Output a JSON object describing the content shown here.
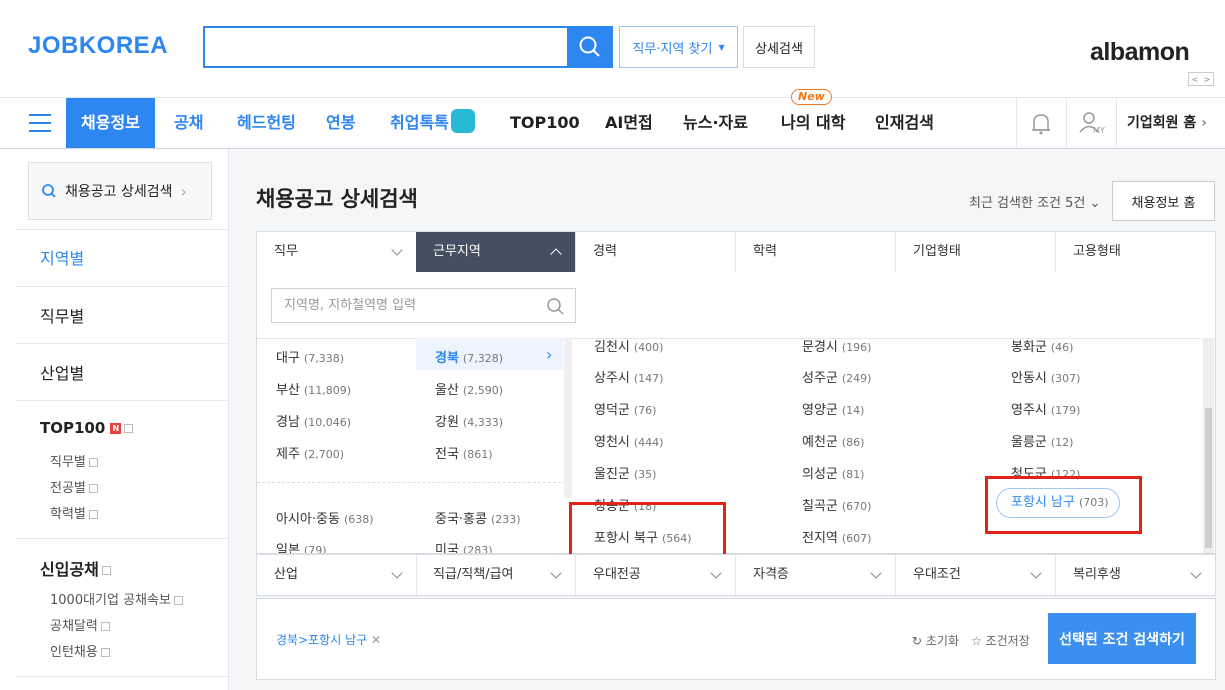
{
  "header": {
    "logo": "JOBKOREA",
    "search_value": "",
    "find_label": "직무·지역 찾기",
    "detail_label": "상세검색",
    "albamon": "albamon"
  },
  "gnb": {
    "items": [
      "채용정보",
      "공채",
      "헤드헌팅",
      "연봉",
      "취업톡톡",
      "TOP100",
      "AI면접",
      "뉴스·자료",
      "나의 대학",
      "인재검색"
    ],
    "new_badge": "New",
    "company_home": "기업회원 홈",
    "my": "MY"
  },
  "sidebar": {
    "search_label": "채용공고 상세검색",
    "sections": [
      "지역별",
      "직무별",
      "산업별"
    ],
    "top100": {
      "label": "TOP100",
      "badge": "N",
      "subs": [
        "직무별",
        "전공별",
        "학력별"
      ]
    },
    "gongchae": {
      "label": "신입공채",
      "subs": [
        "1000대기업 공채속보",
        "공채달력",
        "인턴채용"
      ]
    }
  },
  "main": {
    "title": "채용공고 상세검색",
    "recent": "최근 검색한 조건 5건",
    "home_btn": "채용정보 홈",
    "tabs": [
      "직무",
      "근무지역",
      "경력",
      "학력",
      "기업형태",
      "고용형태"
    ],
    "tabs2": [
      "산업",
      "직급/직책/급여",
      "우대전공",
      "자격증",
      "우대조건",
      "복리후생"
    ],
    "region_placeholder": "지역명, 지하철역명 입력",
    "regions_left": [
      {
        "name": "대구",
        "count": "(7,338)"
      },
      {
        "name": "부산",
        "count": "(11,809)"
      },
      {
        "name": "경남",
        "count": "(10,046)"
      },
      {
        "name": "제주",
        "count": "(2,700)"
      },
      {
        "name": "아시아·중동",
        "count": "(638)"
      },
      {
        "name": "일본",
        "count": "(79)"
      }
    ],
    "regions_mid": [
      {
        "name": "경북",
        "count": "(7,328)"
      },
      {
        "name": "울산",
        "count": "(2,590)"
      },
      {
        "name": "강원",
        "count": "(4,333)"
      },
      {
        "name": "전국",
        "count": "(861)"
      },
      {
        "name": "중국·홍콩",
        "count": "(233)"
      },
      {
        "name": "미국",
        "count": "(283)"
      }
    ],
    "sub_col1": [
      {
        "name": "김천시",
        "count": "(400)"
      },
      {
        "name": "상주시",
        "count": "(147)"
      },
      {
        "name": "영덕군",
        "count": "(76)"
      },
      {
        "name": "영천시",
        "count": "(444)"
      },
      {
        "name": "울진군",
        "count": "(35)"
      },
      {
        "name": "청송군",
        "count": "(18)"
      },
      {
        "name": "포항시 북구",
        "count": "(564)"
      }
    ],
    "sub_col2": [
      {
        "name": "문경시",
        "count": "(196)"
      },
      {
        "name": "성주군",
        "count": "(249)"
      },
      {
        "name": "영양군",
        "count": "(14)"
      },
      {
        "name": "예천군",
        "count": "(86)"
      },
      {
        "name": "의성군",
        "count": "(81)"
      },
      {
        "name": "칠곡군",
        "count": "(670)"
      },
      {
        "name": "전지역",
        "count": "(607)"
      }
    ],
    "sub_col3": [
      {
        "name": "봉화군",
        "count": "(46)"
      },
      {
        "name": "안동시",
        "count": "(307)"
      },
      {
        "name": "영주시",
        "count": "(179)"
      },
      {
        "name": "울릉군",
        "count": "(12)"
      },
      {
        "name": "청도군",
        "count": "(122)"
      },
      {
        "name": "포항시 남구",
        "count": "(703)"
      }
    ],
    "selected_chip": "경북>포항시 남구",
    "reset": "초기화",
    "save": "조건저장",
    "search_selected": "선택된 조건 검색하기"
  }
}
